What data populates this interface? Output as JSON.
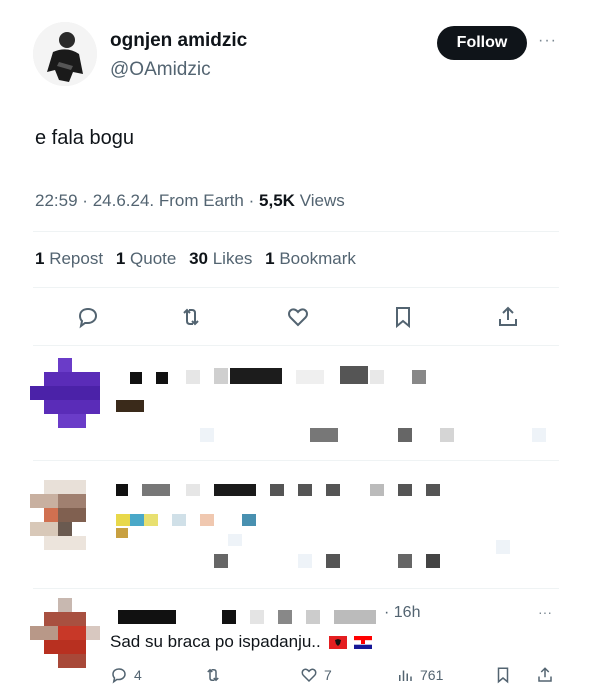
{
  "tweet": {
    "author_name": "ognjen amidzic",
    "author_handle": "@OAmidzic",
    "follow_label": "Follow",
    "more_label": "···",
    "text": "e fala bogu",
    "time": "22:59",
    "date": "24.6.24.",
    "source": "From Earth",
    "views_count": "5,5K",
    "views_label": "Views",
    "separator": "·"
  },
  "stats": {
    "reposts_count": "1",
    "reposts_label": "Repost",
    "quotes_count": "1",
    "quotes_label": "Quote",
    "likes_count": "30",
    "likes_label": "Likes",
    "bookmarks_count": "1",
    "bookmarks_label": "Bookmark"
  },
  "actions": [
    {
      "icon": "reply-icon"
    },
    {
      "icon": "retweet-icon"
    },
    {
      "icon": "like-icon"
    },
    {
      "icon": "bookmark-icon"
    },
    {
      "icon": "share-icon"
    }
  ],
  "reply": {
    "time": "16h",
    "text": "Sad su braca po ispadanju..",
    "more_label": "···",
    "reply_count": "4",
    "like_count": "7",
    "view_count": "761",
    "flags": [
      "albania-flag",
      "croatia-flag"
    ]
  },
  "colors": {
    "text": "#0f1419",
    "secondary": "#536471",
    "follow_bg": "#0f1419",
    "divider": "#eff3f4"
  }
}
